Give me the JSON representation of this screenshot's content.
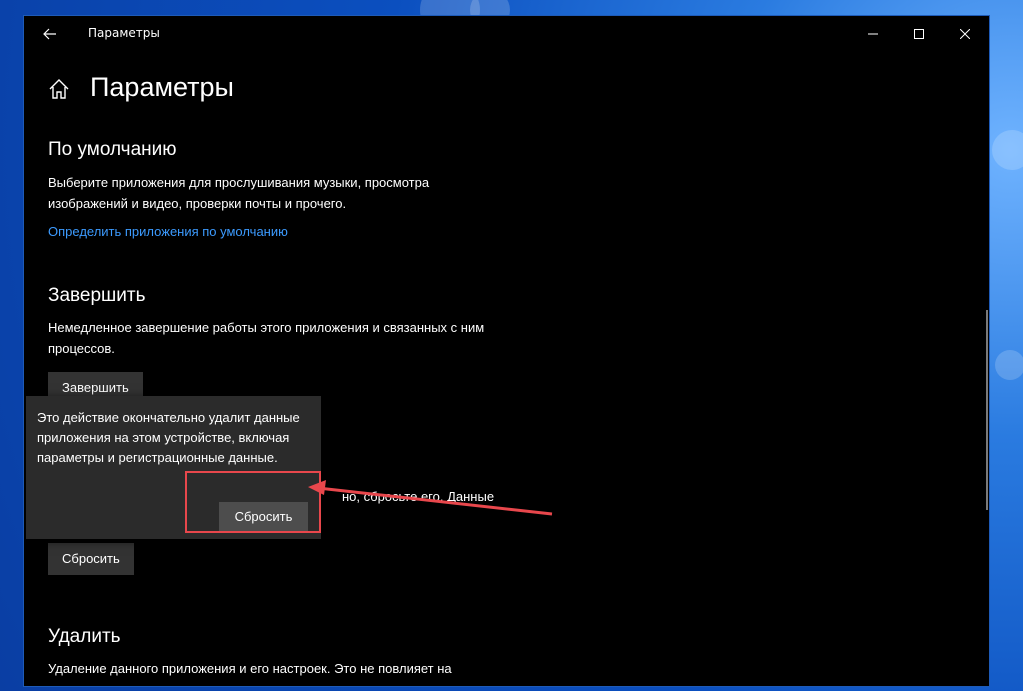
{
  "window": {
    "title": "Параметры",
    "controls": [
      "minimize-icon",
      "maximize-icon",
      "close-icon"
    ]
  },
  "header": {
    "page_title": "Параметры"
  },
  "sections": {
    "defaults": {
      "title": "По умолчанию",
      "description": "Выберите приложения для прослушивания музыки, просмотра изображений и видео, проверки почты и прочего.",
      "link": "Определить приложения по умолчанию"
    },
    "terminate": {
      "title": "Завершить",
      "description": "Немедленное завершение работы этого приложения и связанных с ним процессов.",
      "button": "Завершить"
    },
    "reset": {
      "partial_text": "но, сбросьте его. Данные",
      "button": "Сбросить"
    },
    "uninstall": {
      "title": "Удалить",
      "description": "Удаление данного приложения и его настроек. Это не повлияет на"
    }
  },
  "flyout": {
    "message": "Это действие окончательно удалит данные приложения на этом устройстве, включая параметры и регистрационные данные.",
    "confirm_button": "Сбросить"
  },
  "colors": {
    "accent_link": "#3c9bff",
    "annotation": "#e8474c",
    "window_bg": "#000000",
    "button_bg": "#333333"
  }
}
